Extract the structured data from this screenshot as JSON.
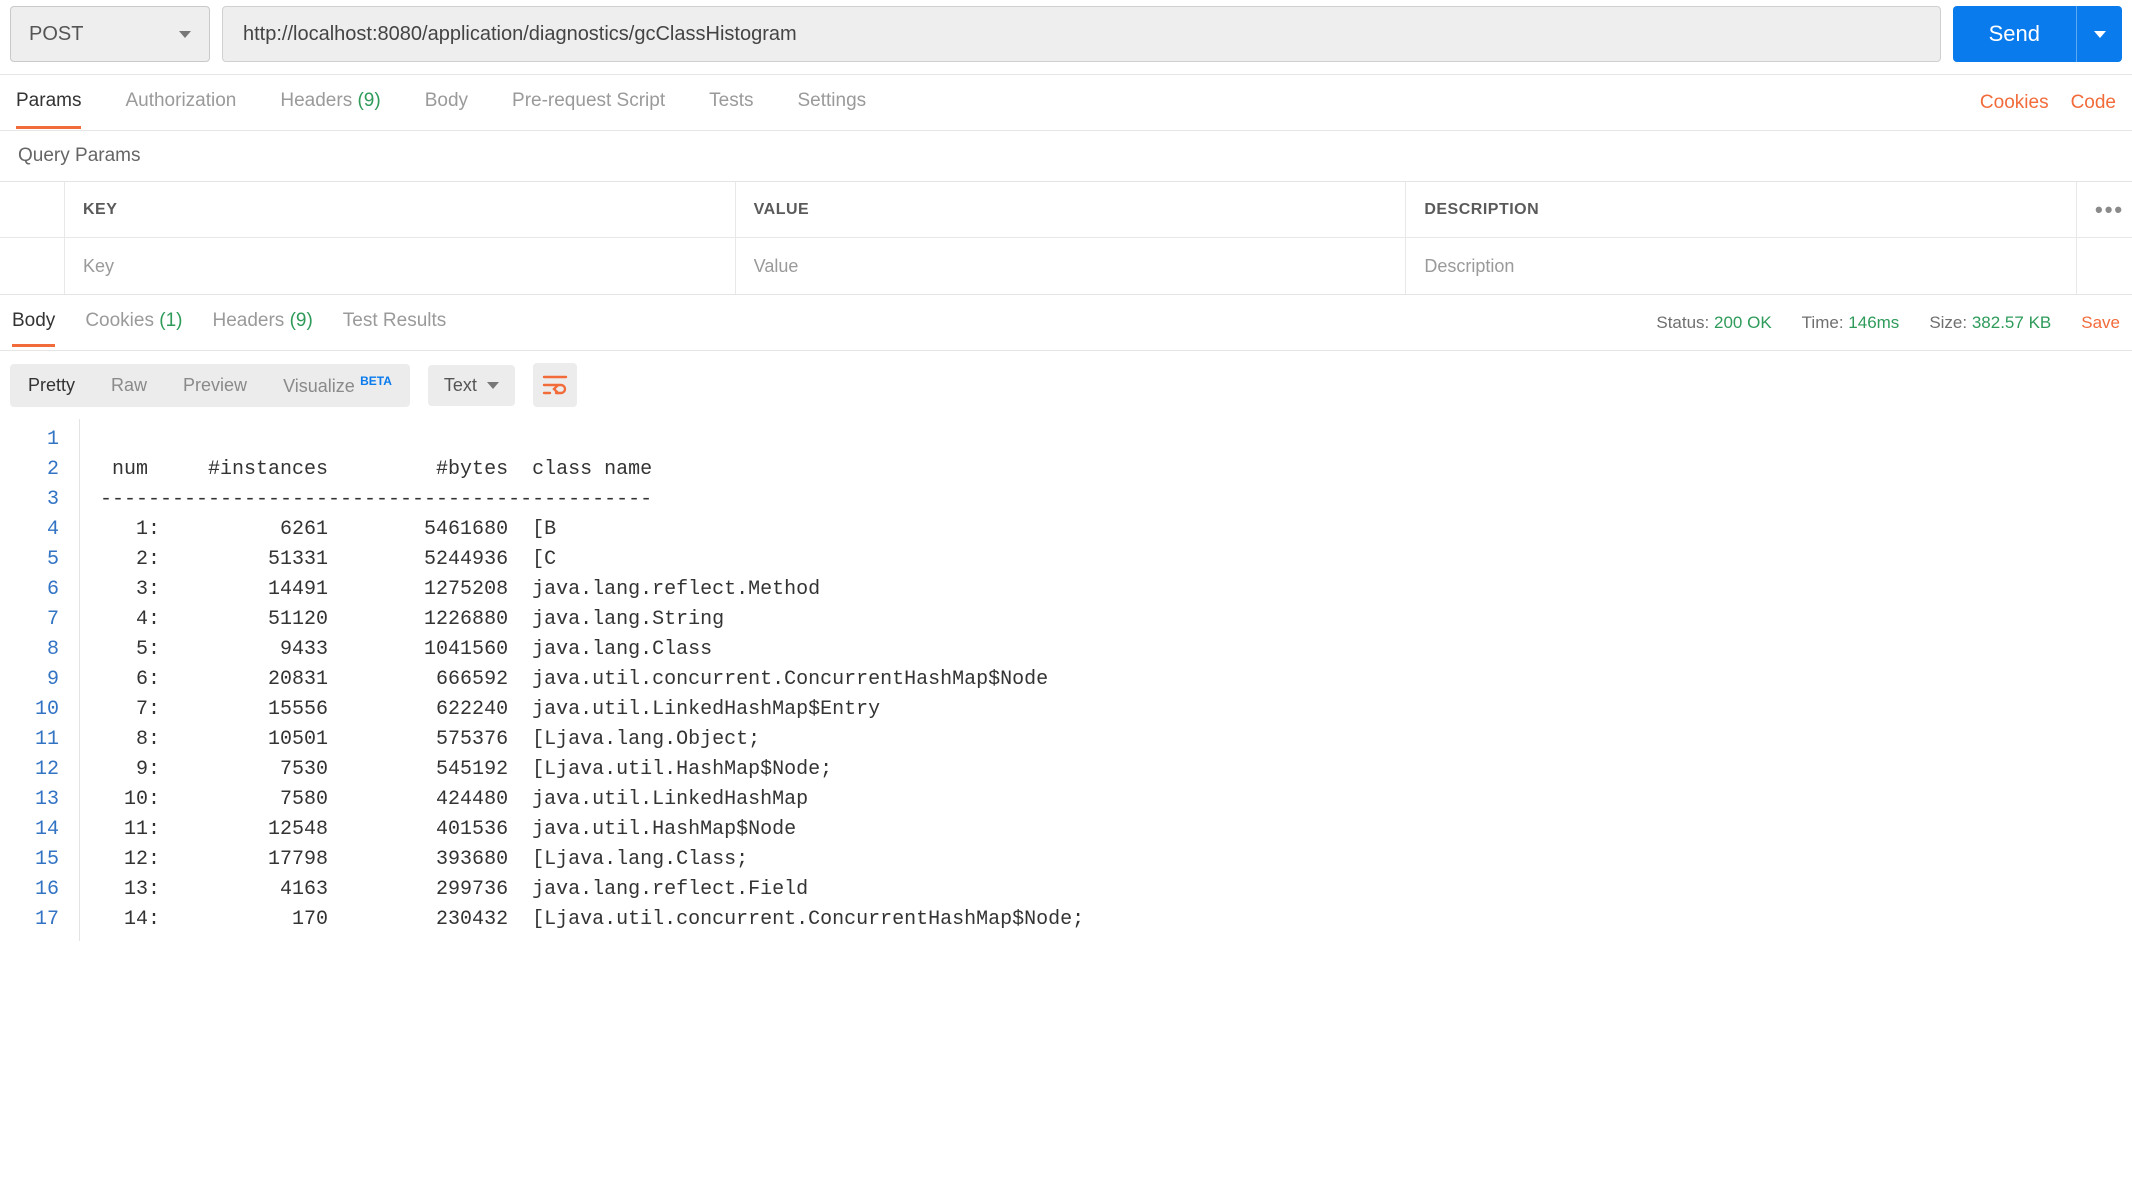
{
  "request": {
    "method": "POST",
    "url": "http://localhost:8080/application/diagnostics/gcClassHistogram",
    "send_label": "Send"
  },
  "req_tabs": {
    "items": [
      {
        "label": "Params",
        "active": true
      },
      {
        "label": "Authorization"
      },
      {
        "label": "Headers",
        "count": "(9)"
      },
      {
        "label": "Body"
      },
      {
        "label": "Pre-request Script"
      },
      {
        "label": "Tests"
      },
      {
        "label": "Settings"
      }
    ],
    "cookies_link": "Cookies",
    "code_link": "Code"
  },
  "query_params": {
    "section_title": "Query Params",
    "headers": {
      "key": "KEY",
      "value": "VALUE",
      "description": "DESCRIPTION"
    },
    "placeholders": {
      "key": "Key",
      "value": "Value",
      "description": "Description"
    }
  },
  "resp_tabs": {
    "items": [
      {
        "label": "Body",
        "active": true
      },
      {
        "label": "Cookies",
        "count": "(1)"
      },
      {
        "label": "Headers",
        "count": "(9)"
      },
      {
        "label": "Test Results"
      }
    ]
  },
  "resp_meta": {
    "status_label": "Status:",
    "status_value": "200 OK",
    "time_label": "Time:",
    "time_value": "146ms",
    "size_label": "Size:",
    "size_value": "382.57 KB",
    "save_label": "Save"
  },
  "body_toolbar": {
    "views": [
      {
        "label": "Pretty",
        "active": true
      },
      {
        "label": "Raw"
      },
      {
        "label": "Preview"
      },
      {
        "label": "Visualize",
        "beta": "BETA"
      }
    ],
    "format": "Text"
  },
  "response_body": {
    "lines": [
      "",
      " num     #instances         #bytes  class name",
      "----------------------------------------------",
      "   1:          6261        5461680  [B",
      "   2:         51331        5244936  [C",
      "   3:         14491        1275208  java.lang.reflect.Method",
      "   4:         51120        1226880  java.lang.String",
      "   5:          9433        1041560  java.lang.Class",
      "   6:         20831         666592  java.util.concurrent.ConcurrentHashMap$Node",
      "   7:         15556         622240  java.util.LinkedHashMap$Entry",
      "   8:         10501         575376  [Ljava.lang.Object;",
      "   9:          7530         545192  [Ljava.util.HashMap$Node;",
      "  10:          7580         424480  java.util.LinkedHashMap",
      "  11:         12548         401536  java.util.HashMap$Node",
      "  12:         17798         393680  [Ljava.lang.Class;",
      "  13:          4163         299736  java.lang.reflect.Field",
      "  14:           170         230432  [Ljava.util.concurrent.ConcurrentHashMap$Node;"
    ]
  }
}
